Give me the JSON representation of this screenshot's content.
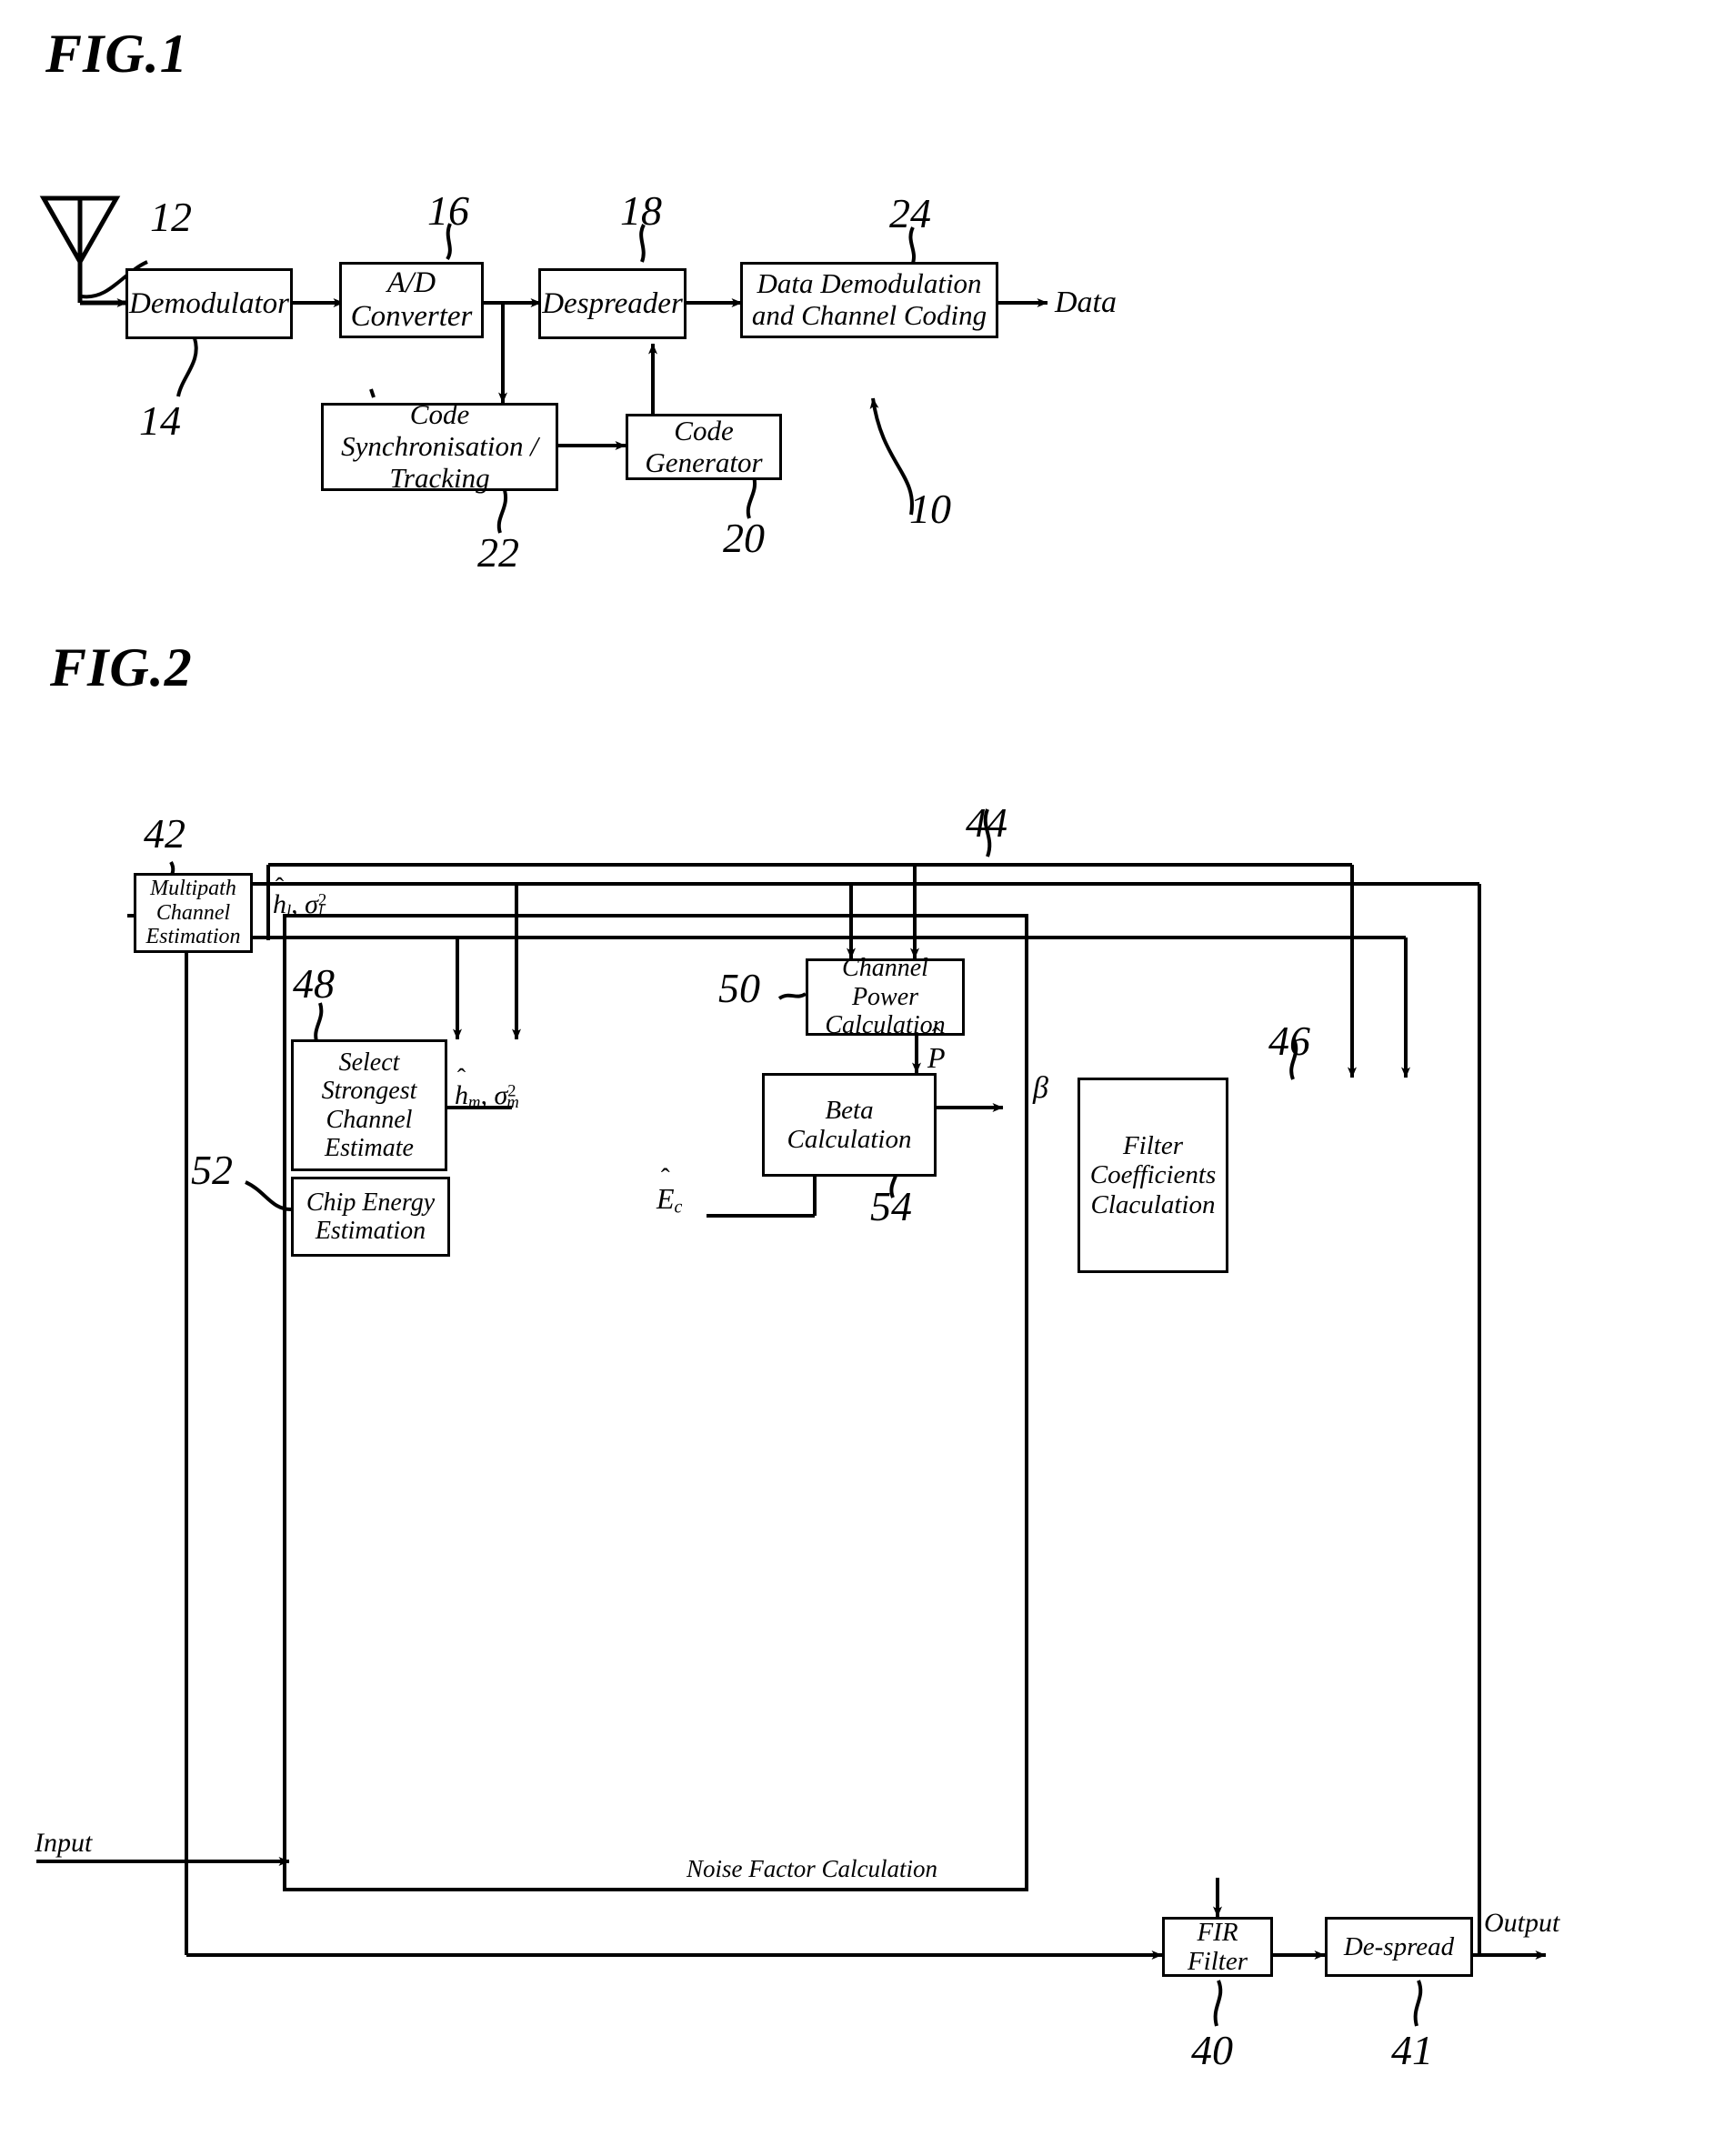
{
  "figures": [
    {
      "id": "fig1",
      "title": "FIG.1",
      "blocks": [
        {
          "key": "demodulator",
          "label": "Demodulator",
          "ref": "14"
        },
        {
          "key": "ad_converter",
          "label": "A/D Converter",
          "ref": "16"
        },
        {
          "key": "despreader",
          "label": "Despreader",
          "ref": "18"
        },
        {
          "key": "data_demod",
          "label": "Data Demodulation and Channel Coding",
          "ref": "24"
        },
        {
          "key": "code_sync",
          "label": "Code Synchronisation / Tracking",
          "ref": "22"
        },
        {
          "key": "code_gen",
          "label": "Code Generator",
          "ref": "20"
        }
      ],
      "labels": {
        "antenna_ref": "12",
        "system_ref": "10",
        "data_out": "Data"
      }
    },
    {
      "id": "fig2",
      "title": "FIG.2",
      "blocks": [
        {
          "key": "multipath",
          "label": "Multipath Channel Estimation",
          "ref": "42"
        },
        {
          "key": "select_strongest",
          "label": "Select Strongest Channel Estimate",
          "ref": "48"
        },
        {
          "key": "channel_power",
          "label": "Channel Power Calculation",
          "ref": "50"
        },
        {
          "key": "beta_calc",
          "label": "Beta Calculation",
          "ref": "54"
        },
        {
          "key": "chip_energy",
          "label": "Chip Energy Estimation",
          "ref": "52"
        },
        {
          "key": "filter_coeffs",
          "label": "Filter Coefficients Claculation",
          "ref": "46"
        },
        {
          "key": "fir_filter",
          "label": "FIR Filter",
          "ref": "40"
        },
        {
          "key": "despread",
          "label": "De-spread",
          "ref": "41"
        }
      ],
      "group": {
        "caption": "Noise Factor Calculation",
        "ref": "44"
      },
      "labels": {
        "input": "Input",
        "output": "Output",
        "sig_hl": "ĥₗ , σ²ₗ",
        "sig_hm": "ĥₘ , σ²ₘ",
        "sig_P": "P̂",
        "sig_Ec": "Êᴄ",
        "sig_beta": "β"
      }
    }
  ],
  "fig1_blocks_text": {
    "demodulator": "Demodulator",
    "ad_converter_l1": "A/D",
    "ad_converter_l2": "Converter",
    "despreader": "Despreader",
    "data_demod_l1": "Data Demodulation",
    "data_demod_l2": "and Channel Coding",
    "code_sync_l1": "Code",
    "code_sync_l2": "Synchronisation /",
    "code_sync_l3": "Tracking",
    "code_gen_l1": "Code",
    "code_gen_l2": "Generator"
  },
  "fig1_refs": {
    "r12": "12",
    "r14": "14",
    "r16": "16",
    "r18": "18",
    "r20": "20",
    "r22": "22",
    "r24": "24",
    "r10": "10"
  },
  "fig1_io": {
    "data": "Data"
  },
  "fig2_blocks_text": {
    "multipath_l1": "Multipath",
    "multipath_l2": "Channel",
    "multipath_l3": "Estimation",
    "select_l1": "Select",
    "select_l2": "Strongest",
    "select_l3": "Channel",
    "select_l4": "Estimate",
    "power_l1": "Channel",
    "power_l2": "Power",
    "power_l3": "Calculation",
    "beta_l1": "Beta",
    "beta_l2": "Calculation",
    "chip_l1": "Chip Energy",
    "chip_l2": "Estimation",
    "coeff_l1": "Filter",
    "coeff_l2": "Coefficients",
    "coeff_l3": "Claculation",
    "fir": "FIR Filter",
    "despread": "De-spread",
    "group_caption": "Noise Factor Calculation"
  },
  "fig2_refs": {
    "r40": "40",
    "r41": "41",
    "r42": "42",
    "r44": "44",
    "r46": "46",
    "r48": "48",
    "r50": "50",
    "r52": "52",
    "r54": "54"
  },
  "fig2_io": {
    "input": "Input",
    "output": "Output"
  },
  "fig2_signals": {
    "hl": "h",
    "hl_sub": "l",
    "sigma_l": "σ",
    "sigma_l_sub": "l",
    "sigma_l_sup": "2",
    "hm": "h",
    "hm_sub": "m",
    "sigma_m": "σ",
    "sigma_m_sub": "m",
    "sigma_m_sup": "2",
    "P": "P",
    "Ec": "E",
    "Ec_sub": "c",
    "beta": "β",
    "comma": ","
  },
  "titles": {
    "fig1": "FIG.1",
    "fig2": "FIG.2"
  },
  "colors": {
    "ink": "#000000",
    "paper": "#ffffff"
  }
}
